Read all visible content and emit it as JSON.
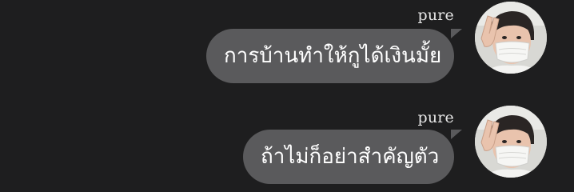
{
  "messages": [
    {
      "sender": "pure",
      "text": "การบ้านทำให้กูได้เงินมั้ย",
      "avatar_icon": "user-avatar-masked-peace-sign"
    },
    {
      "sender": "pure",
      "text": "ถ้าไม่ก็อย่าสำคัญตัว",
      "avatar_icon": "user-avatar-masked-peace-sign"
    }
  ],
  "colors": {
    "background": "#1e1e1f",
    "bubble": "#5a5a5c",
    "text": "#ffffff",
    "sender": "#e6e6e6"
  }
}
